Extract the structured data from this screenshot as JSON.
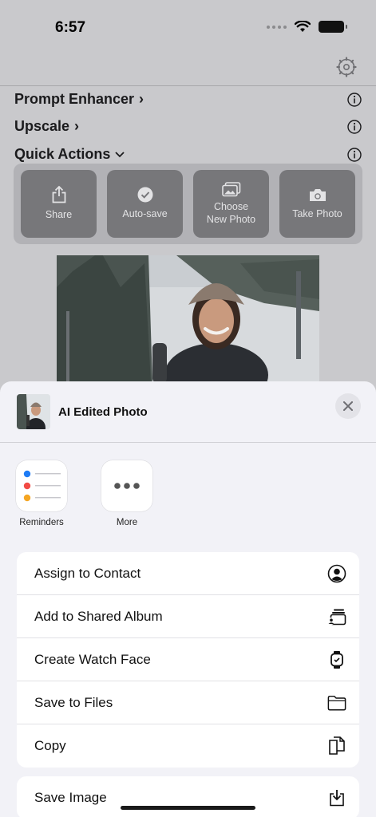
{
  "status_bar": {
    "time": "6:57"
  },
  "background_app": {
    "rows": [
      {
        "label": "Prompt Enhancer",
        "chevron": "›"
      },
      {
        "label": "Upscale",
        "chevron": "›"
      },
      {
        "label": "Quick Actions",
        "chevron": "⌄"
      }
    ],
    "quick_actions": [
      {
        "label": "Share",
        "icon": "share-icon"
      },
      {
        "label": "Auto-save",
        "icon": "checkmark-circle-icon"
      },
      {
        "label": "Choose New Photo",
        "icon": "photo-library-icon"
      },
      {
        "label": "Take Photo",
        "icon": "camera-icon"
      }
    ]
  },
  "share_sheet": {
    "title": "AI Edited Photo",
    "apps": [
      {
        "label": "Reminders",
        "icon": "reminders-icon"
      },
      {
        "label": "More",
        "icon": "more-icon"
      }
    ],
    "actions": [
      {
        "label": "Assign to Contact",
        "icon": "person-circle-icon"
      },
      {
        "label": "Add to Shared Album",
        "icon": "shared-album-icon"
      },
      {
        "label": "Create Watch Face",
        "icon": "watch-icon"
      },
      {
        "label": "Save to Files",
        "icon": "folder-icon"
      },
      {
        "label": "Copy",
        "icon": "copy-icon"
      }
    ],
    "actions_2": [
      {
        "label": "Save Image",
        "icon": "save-download-icon"
      }
    ]
  }
}
